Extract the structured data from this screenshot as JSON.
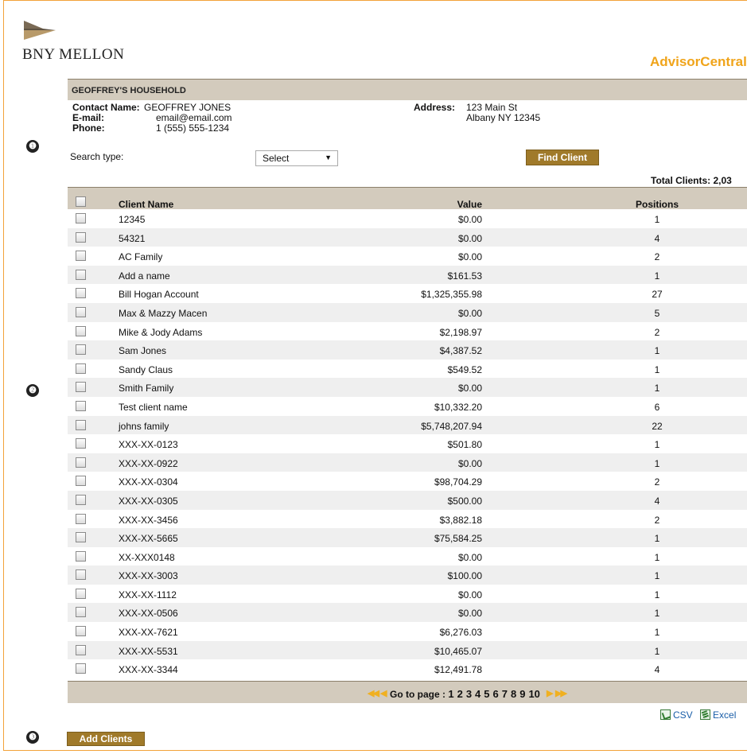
{
  "brand": {
    "logo_text": "BNY MELLON",
    "product": "AdvisorCentral",
    "product_mark": "®",
    "accent_color": "#f0a41a",
    "header_color": "#d3cbbd",
    "button_color": "#a07a2a"
  },
  "steps": [
    "❶",
    "❷",
    "❸"
  ],
  "household": {
    "title": "GEOFFREY'S HOUSEHOLD",
    "contact_label": "Contact Name:",
    "contact_value": "GEOFFREY JONES",
    "email_label": "E-mail:",
    "email_value": "email@email.com",
    "phone_label": "Phone:",
    "phone_value": "1 (555) 555-1234",
    "address_label": "Address:",
    "address_line1": "123 Main St",
    "address_line2": "Albany NY 12345"
  },
  "search": {
    "label": "Search type:",
    "selected": "Select",
    "find_button": "Find Client"
  },
  "total_clients": "Total Clients: 2,03",
  "table": {
    "headers": {
      "name": "Client Name",
      "value": "Value",
      "positions": "Positions"
    },
    "rows": [
      {
        "name": "12345",
        "value": "$0.00",
        "positions": "1"
      },
      {
        "name": "54321",
        "value": "$0.00",
        "positions": "4"
      },
      {
        "name": "AC Family",
        "value": "$0.00",
        "positions": "2"
      },
      {
        "name": "Add a name",
        "value": "$161.53",
        "positions": "1"
      },
      {
        "name": "Bill Hogan Account",
        "value": "$1,325,355.98",
        "positions": "27"
      },
      {
        "name": "Max & Mazzy Macen",
        "value": "$0.00",
        "positions": "5"
      },
      {
        "name": "Mike & Jody Adams",
        "value": "$2,198.97",
        "positions": "2"
      },
      {
        "name": "Sam Jones",
        "value": "$4,387.52",
        "positions": "1"
      },
      {
        "name": "Sandy Claus",
        "value": "$549.52",
        "positions": "1"
      },
      {
        "name": "Smith Family",
        "value": "$0.00",
        "positions": "1"
      },
      {
        "name": "Test client name",
        "value": "$10,332.20",
        "positions": "6"
      },
      {
        "name": "johns family",
        "value": "$5,748,207.94",
        "positions": "22"
      },
      {
        "name": "XXX-XX-0123",
        "value": "$501.80",
        "positions": "1"
      },
      {
        "name": "XXX-XX-0922",
        "value": "$0.00",
        "positions": "1"
      },
      {
        "name": "XXX-XX-0304",
        "value": "$98,704.29",
        "positions": "2"
      },
      {
        "name": "XXX-XX-0305",
        "value": "$500.00",
        "positions": "4"
      },
      {
        "name": "XXX-XX-3456",
        "value": "$3,882.18",
        "positions": "2"
      },
      {
        "name": "XXX-XX-5665",
        "value": "$75,584.25",
        "positions": "1"
      },
      {
        "name": "XX-XXX0148",
        "value": "$0.00",
        "positions": "1"
      },
      {
        "name": "XXX-XX-3003",
        "value": "$100.00",
        "positions": "1"
      },
      {
        "name": "XXX-XX-1112",
        "value": "$0.00",
        "positions": "1"
      },
      {
        "name": "XXX-XX-0506",
        "value": "$0.00",
        "positions": "1"
      },
      {
        "name": "XXX-XX-7621",
        "value": "$6,276.03",
        "positions": "1"
      },
      {
        "name": "XXX-XX-5531",
        "value": "$10,465.07",
        "positions": "1"
      },
      {
        "name": "XXX-XX-3344",
        "value": "$12,491.78",
        "positions": "4"
      }
    ]
  },
  "pager": {
    "label": "Go to page :",
    "pages": [
      "1",
      "2",
      "3",
      "4",
      "5",
      "6",
      "7",
      "8",
      "9",
      "10"
    ],
    "current_page": "1"
  },
  "exports": {
    "csv": "CSV",
    "excel": "Excel"
  },
  "add_clients_button": "Add Clients"
}
